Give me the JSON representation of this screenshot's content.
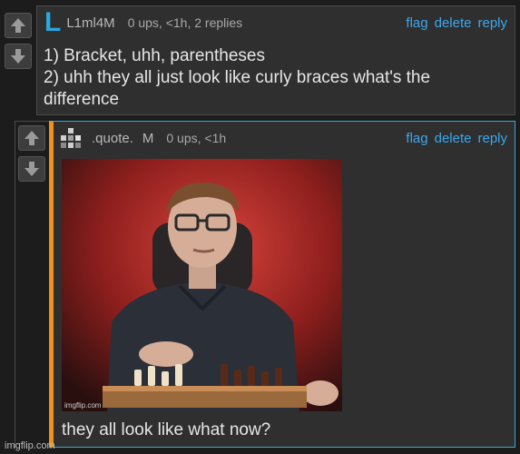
{
  "comment1": {
    "username": "L1ml4M",
    "meta": "0 ups, <1h, 2 replies",
    "actions": {
      "flag": "flag",
      "delete": "delete",
      "reply": "reply"
    },
    "lines": [
      "1) Bracket, uhh, parentheses",
      "2) uhh they all just look like curly braces what's the",
      "difference"
    ],
    "avatar_letter": "L",
    "avatar_color": "#29a8e0"
  },
  "comment2": {
    "username": ".quote.",
    "badge": "M",
    "meta": "0 ups, <1h",
    "actions": {
      "flag": "flag",
      "delete": "delete",
      "reply": "reply"
    },
    "image_caption": "imgflip.com",
    "text": "they all look like what now?",
    "accent_border": "#f0901e",
    "outline_color": "#39a7d9"
  },
  "watermark": "imgflip.com"
}
